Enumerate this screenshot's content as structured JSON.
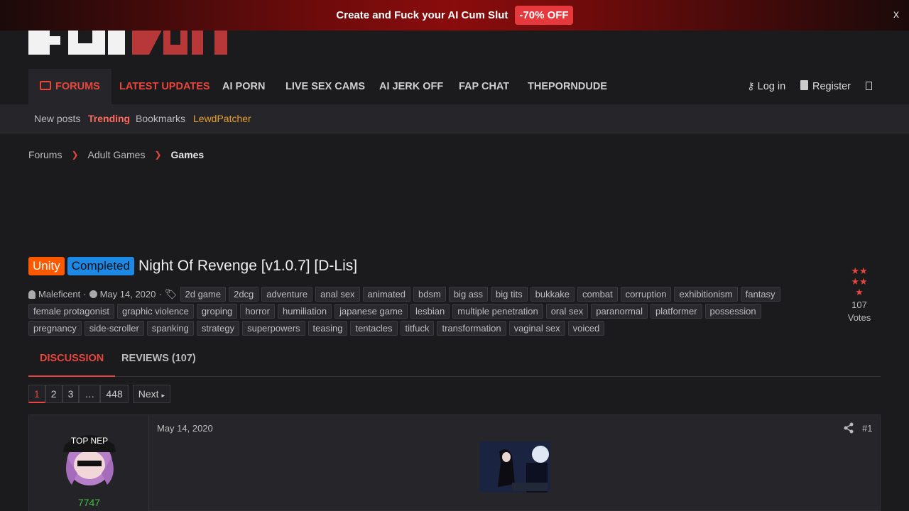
{
  "promo": {
    "text": "Create and Fuck your AI Cum Slut",
    "badge": "-70% OFF",
    "close": "x"
  },
  "nav": {
    "items": [
      "FORUMS",
      "LATEST UPDATES",
      "AI PORN",
      "LIVE SEX CAMS",
      "AI JERK OFF",
      "FAP CHAT",
      "THEPORNDUDE"
    ],
    "login": "Log in",
    "register": "Register"
  },
  "subnav": [
    "New posts",
    "Trending",
    "Bookmarks",
    "LewdPatcher"
  ],
  "breadcrumb": [
    "Forums",
    "Adult Games",
    "Games"
  ],
  "thread": {
    "prefixes": [
      "Unity",
      "Completed"
    ],
    "title": "Night Of Revenge [v1.0.7] [D-Lis]",
    "author": "Maleficent",
    "date": "May 14, 2020",
    "tags": [
      "2d game",
      "2dcg",
      "adventure",
      "anal sex",
      "animated",
      "bdsm",
      "big ass",
      "big tits",
      "bukkake",
      "combat",
      "corruption",
      "exhibitionism",
      "fantasy",
      "female protagonist",
      "graphic violence",
      "groping",
      "horror",
      "humiliation",
      "japanese game",
      "lesbian",
      "multiple penetration",
      "oral sex",
      "paranormal",
      "platformer",
      "possession",
      "pregnancy",
      "side-scroller",
      "spanking",
      "strategy",
      "superpowers",
      "teasing",
      "tentacles",
      "titfuck",
      "transformation",
      "vaginal sex",
      "voiced"
    ],
    "rating": {
      "stars": 4.5,
      "votes": "107",
      "votes_label": "Votes"
    }
  },
  "tabs": [
    "DISCUSSION",
    "REVIEWS (107)"
  ],
  "pager": {
    "pages": [
      "1",
      "2",
      "3",
      "…",
      "448"
    ],
    "current": "1",
    "next": "Next"
  },
  "post": {
    "date": "May 14, 2020",
    "number": "#1",
    "username": "7747",
    "avatar_text": "TOP NEP"
  },
  "colors": {
    "accent": "#e8453c",
    "unity": "#fe5901",
    "completed": "#1e88e5",
    "trending": "#ff6b5e",
    "lewdpatcher": "#e8a030",
    "username": "#3fbf3f"
  }
}
